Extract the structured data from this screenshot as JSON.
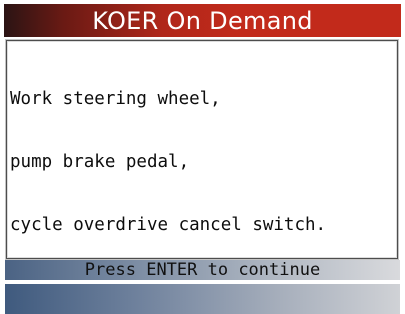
{
  "header": {
    "title": "KOER On Demand"
  },
  "message": {
    "lines": [
      "Work steering wheel,",
      "pump brake pedal,",
      "cycle overdrive cancel switch."
    ]
  },
  "footer": {
    "prompt": "Press ENTER to continue"
  },
  "colors": {
    "title_bar": "#c22a1b",
    "prompt_bar_start": "#4b6384",
    "prompt_bar_end": "#d9dadd"
  }
}
